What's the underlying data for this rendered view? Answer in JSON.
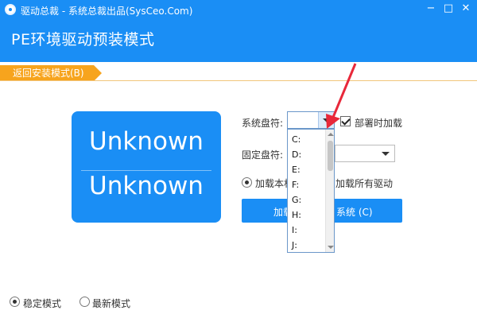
{
  "window": {
    "title": "驱动总裁 - 系统总裁出品(SysCeo.Com)",
    "subtitle": "PE环境驱动预装模式",
    "minimize_glyph": "−",
    "maximize_glyph": "□",
    "close_glyph": "✕"
  },
  "back_tab": {
    "label": "返回安装模式(B)"
  },
  "info_card": {
    "line1": "Unknown",
    "line2": "Unknown"
  },
  "system_drive": {
    "label": "系统盘符:",
    "value": "",
    "options": [
      "C:",
      "D:",
      "E:",
      "F:",
      "G:",
      "H:",
      "I:",
      "J:"
    ]
  },
  "deploy_load": {
    "label": "部署时加载",
    "checked": true
  },
  "fixed_drive": {
    "label": "固定盘符:",
    "value": ""
  },
  "load_options": {
    "option1_label": "加载本机",
    "option2_label": "加载所有驱动",
    "selected": "option1"
  },
  "load_button": {
    "label_left": "加载",
    "label_right": "系统 (C)"
  },
  "modes": {
    "stable_label": "稳定模式",
    "latest_label": "最新模式",
    "selected": "stable"
  },
  "colors": {
    "accent": "#1a8ef5",
    "tab": "#f7a41d",
    "annotation_arrow": "#e8283a"
  }
}
